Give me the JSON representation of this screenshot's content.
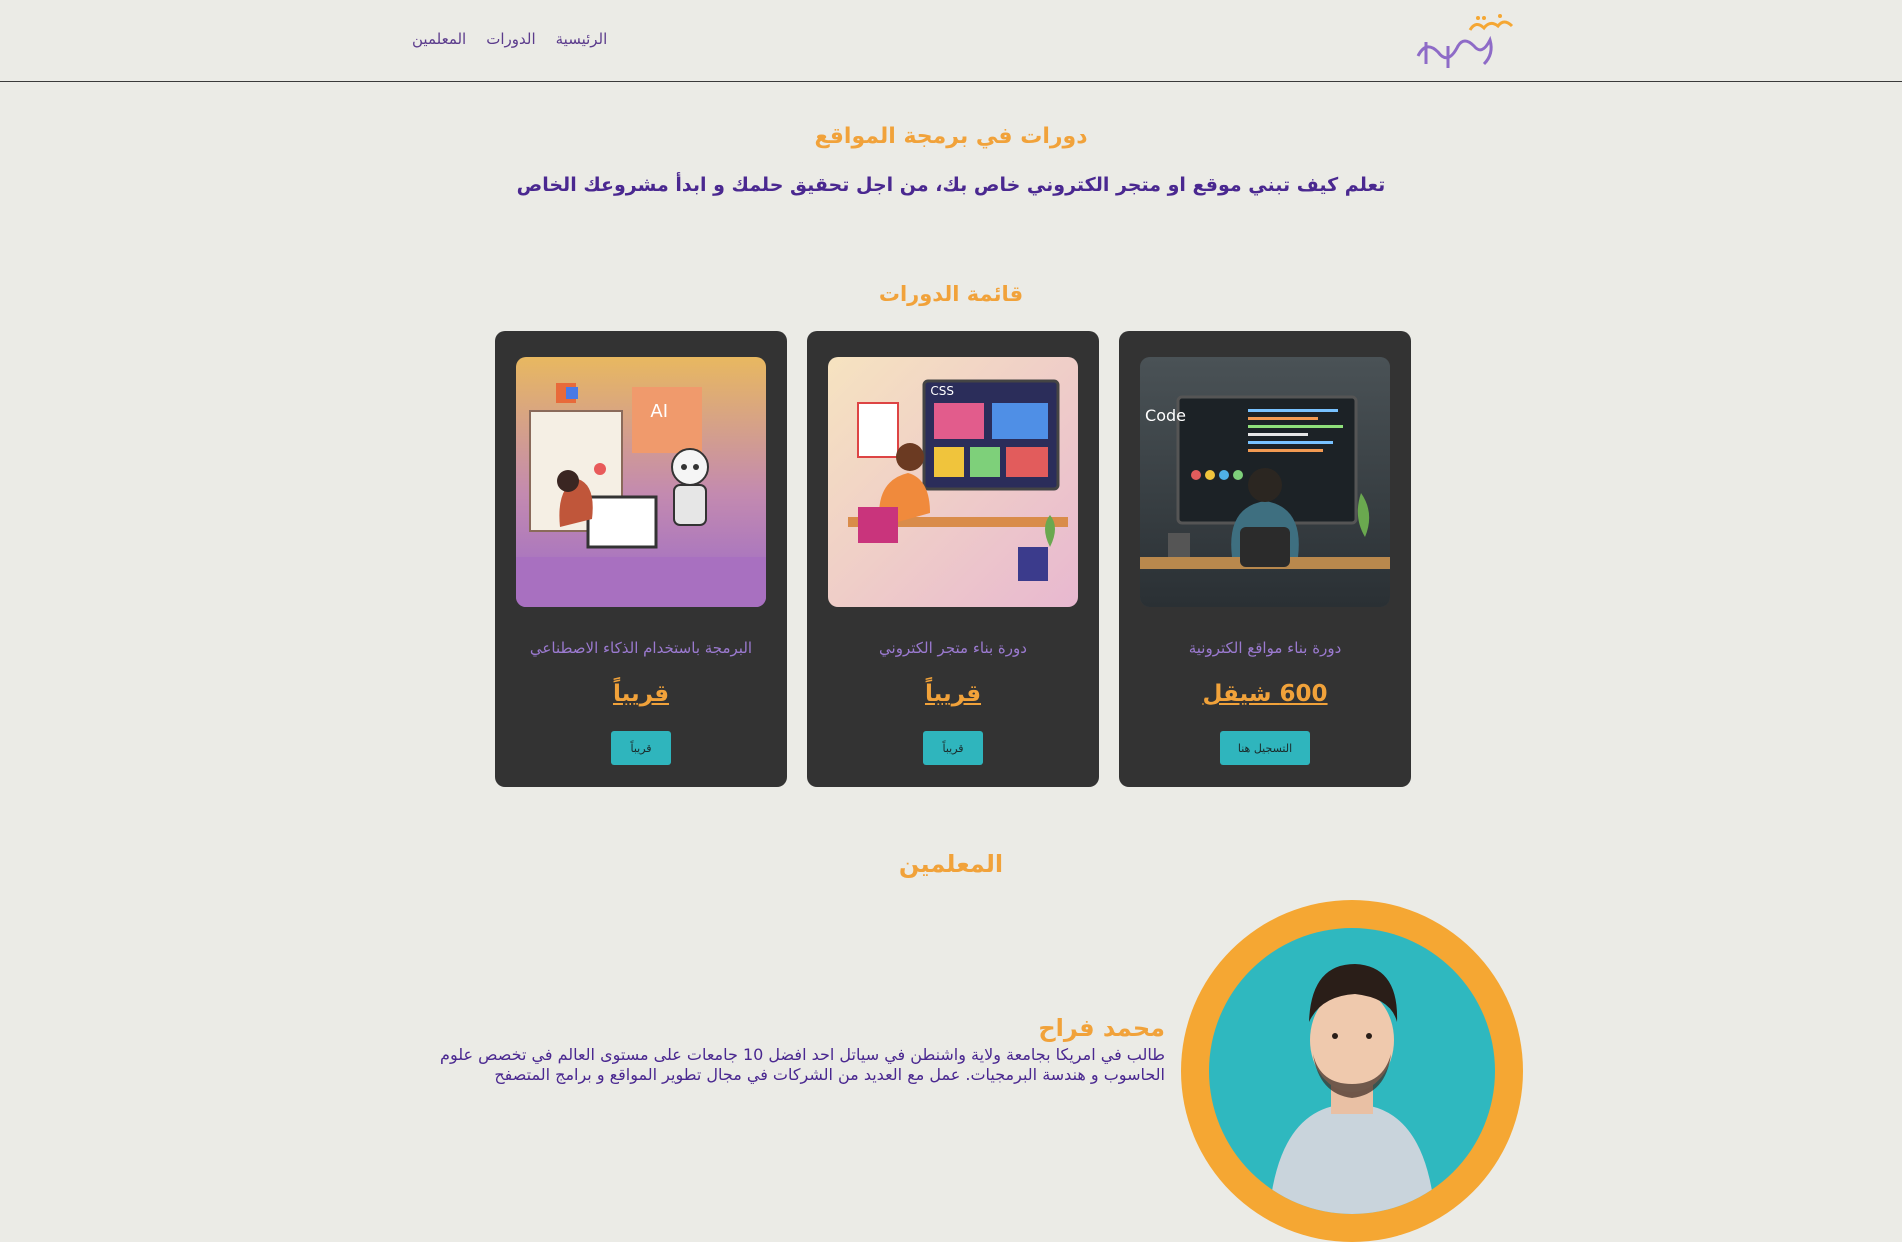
{
  "header": {
    "nav": [
      "الرئيسية",
      "الدورات",
      "المعلمين"
    ]
  },
  "hero": {
    "title": "دورات في برمجة المواقع",
    "subtitle": "تعلم كيف تبني موقع او متجر الكتروني خاص بك، من اجل تحقيق حلمك و ابدأ مشروعك الخاص"
  },
  "courses": {
    "title": "قائمة الدورات",
    "items": [
      {
        "name": "دورة بناء مواقع الكترونية",
        "price": "600 شيقل",
        "button": "التسجيل هنا",
        "image": "code-developer-illustration"
      },
      {
        "name": "دورة بناء متجر الكتروني",
        "price": "قريباً",
        "button": "قريباً",
        "image": "online-store-illustration"
      },
      {
        "name": "البرمجة باستخدام الذكاء الاصطناعي",
        "price": "قريباً",
        "button": "قريباً",
        "image": "ai-robot-illustration"
      }
    ]
  },
  "teachers": {
    "title": "المعلمين",
    "items": [
      {
        "name": "محمد فراح",
        "bio": "طالب في امريكا بجامعة ولاية واشنطن في سياتل احد افضل 10 جامعات على مستوى العالم في تخصص علوم الحاسوب و هندسة البرمجيات. عمل مع العديد من الشركات في مجال تطوير المواقع و برامج المتصفح"
      }
    ]
  },
  "colors": {
    "background": "#ebebe6",
    "accent": "#f1a23a",
    "primary": "#4a2890",
    "card": "#333333",
    "button": "#2fb5bd"
  }
}
